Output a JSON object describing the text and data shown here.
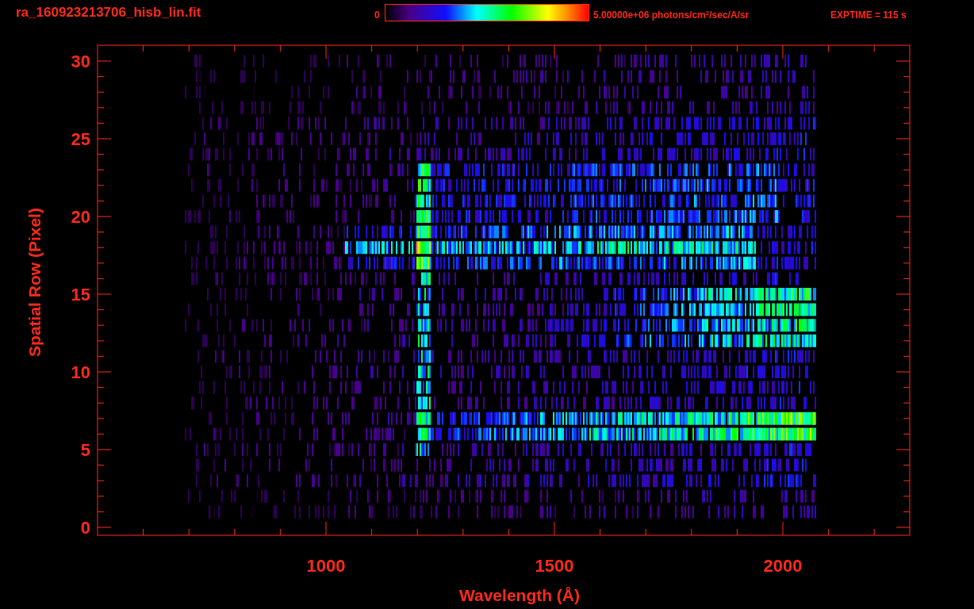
{
  "header": {
    "filename": "ra_160923213706_hisb_lin.fit",
    "colorbar_min": "0",
    "colorbar_max": "5.00000e+06 photons/cm$^{2}$/sec/A/sr",
    "exptime": "EXPTIME = 115 s"
  },
  "plot": {
    "ylabel": "Spatial Row (Pixel)",
    "xlabel": "Wavelength (Å)",
    "yticks": [
      "30",
      "25",
      "20",
      "15",
      "10",
      "5",
      "0"
    ],
    "xticks": [
      "1000",
      "1500",
      "2000"
    ]
  }
}
